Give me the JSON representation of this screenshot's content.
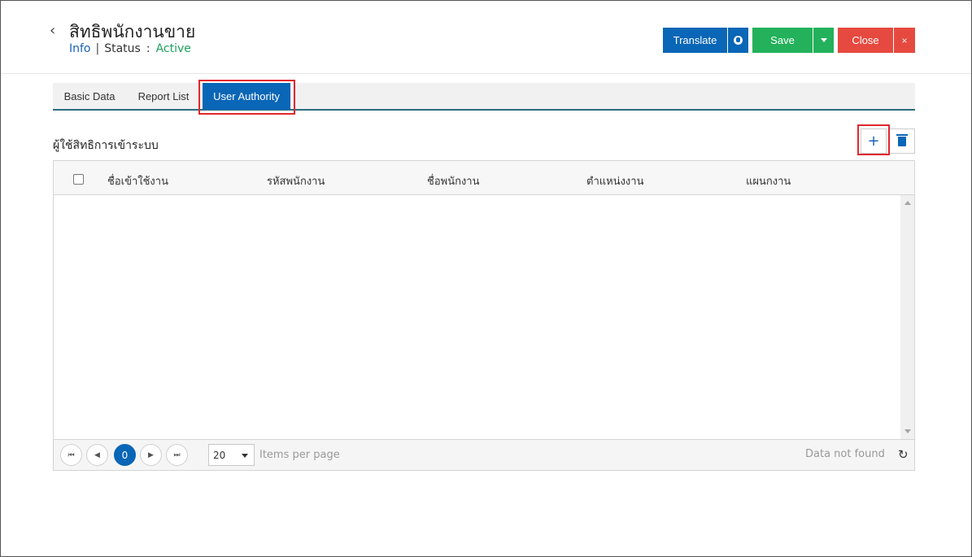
{
  "header": {
    "back_icon": "chevron-left-icon",
    "title": "สิทธิพนักงานขาย",
    "info_link": "Info",
    "separator": "|",
    "status_label": "Status",
    "status_colon": ":",
    "status_value": "Active"
  },
  "toolbar": {
    "translate_label": "Translate",
    "globe_icon": "globe-icon",
    "save_label": "Save",
    "save_dropdown_icon": "caret-down-icon",
    "close_label": "Close",
    "close_x": "×"
  },
  "tabs": [
    {
      "label": "Basic Data",
      "active": false
    },
    {
      "label": "Report List",
      "active": false
    },
    {
      "label": "User Authority",
      "active": true
    }
  ],
  "section": {
    "title": "ผู้ใช้สิทธิการเข้าระบบ",
    "add_symbol": "+",
    "delete_icon": "trash-icon"
  },
  "grid": {
    "columns": [
      "ชื่อเข้าใช้งาน",
      "รหัสพนักงาน",
      "ชื่อพนักงาน",
      "ตำแหน่งงาน",
      "แผนกงาน"
    ],
    "rows": []
  },
  "pager": {
    "first": "⏮",
    "prev": "◀",
    "current_page": "0",
    "next": "▶",
    "last": "⏭",
    "page_size": "20",
    "items_per_page_label": "Items per page",
    "status_text": "Data not found",
    "refresh_glyph": "↻"
  },
  "colors": {
    "primary": "#0a66b6",
    "success": "#23b15b",
    "danger": "#e6493f",
    "active_status": "#1ca35a",
    "highlight": "#e0282e"
  }
}
